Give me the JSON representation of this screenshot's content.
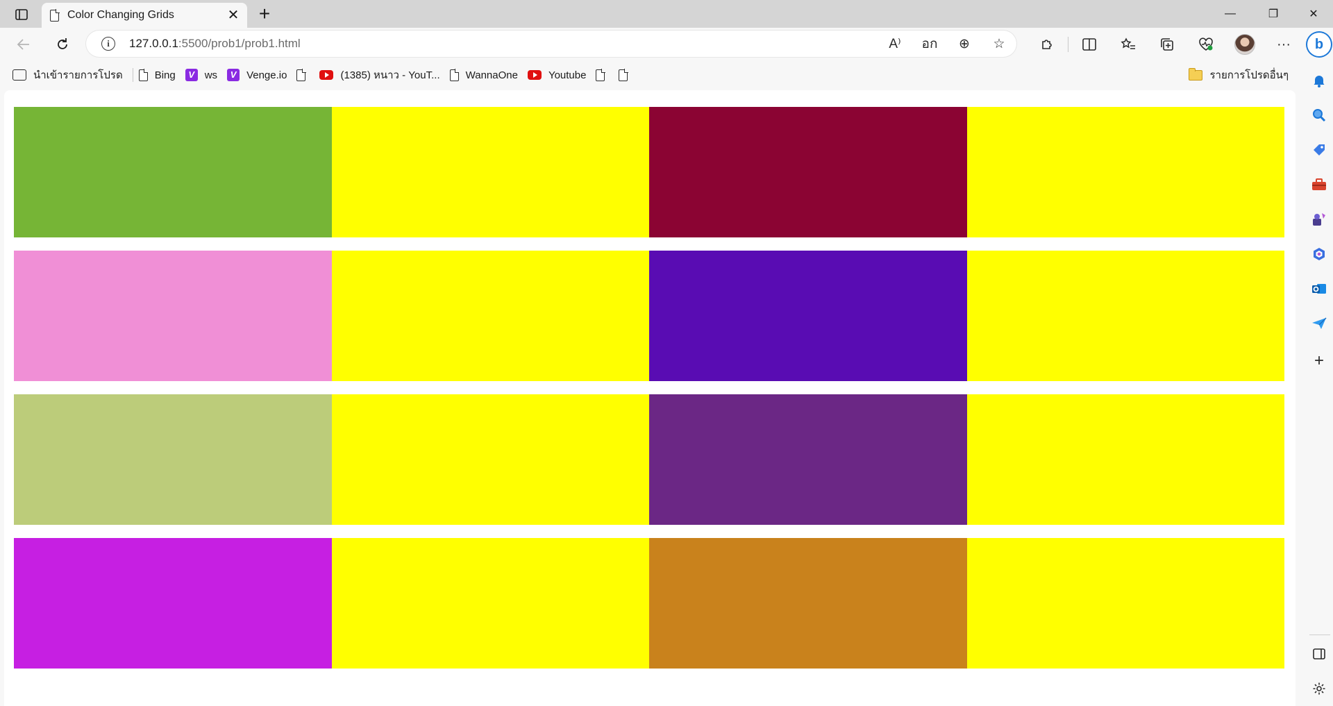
{
  "browser": {
    "tab": {
      "title": "Color Changing Grids",
      "close_glyph": "✕"
    },
    "new_tab_glyph": "+",
    "window_controls": {
      "minimize": "—",
      "restore": "❐",
      "close": "✕"
    },
    "address": {
      "host": "127.0.0.1",
      "path": ":5500/prob1/prob1.html"
    },
    "omnibox_icons": {
      "read_aloud": "A⁾",
      "translate": "อก",
      "zoom": "⊕",
      "favorite": "☆"
    },
    "toolbar": {
      "extensions": "⧉",
      "split": "◫",
      "favorites": "☆",
      "collections": "⧉",
      "performance": "♡",
      "menu": "···"
    }
  },
  "bookmarks": [
    {
      "label": "นำเข้ารายการโปรด",
      "icon": "import-icon"
    },
    {
      "label": "Bing",
      "icon": "doc-icon"
    },
    {
      "label": "ws",
      "icon": "v-icon"
    },
    {
      "label": "Venge.io",
      "icon": "v-icon"
    },
    {
      "label": "",
      "icon": "doc-icon"
    },
    {
      "label": "(1385) หนาว - YouT...",
      "icon": "youtube-icon"
    },
    {
      "label": "WannaOne",
      "icon": "doc-icon"
    },
    {
      "label": "Youtube",
      "icon": "youtube-icon"
    },
    {
      "label": "",
      "icon": "doc-icon"
    },
    {
      "label": "",
      "icon": "doc-icon"
    }
  ],
  "other_favorites": {
    "label": "รายการโปรดอื่นๆ",
    "icon": "folder-icon"
  },
  "grid": {
    "rows": 4,
    "cols": 4,
    "colors": [
      [
        "#76b536",
        "#ffff00",
        "#8b0433",
        "#ffff00"
      ],
      [
        "#f08fd6",
        "#ffff00",
        "#590cb3",
        "#ffff00"
      ],
      [
        "#bccc7a",
        "#ffff00",
        "#6b2785",
        "#ffff00"
      ],
      [
        "#c61fe2",
        "#ffff00",
        "#c9821c",
        "#ffff00"
      ]
    ]
  },
  "sidebar": {
    "bing_label": "b",
    "items": [
      "bell-icon",
      "search-icon",
      "shopping-tag-icon",
      "toolbox-icon",
      "games-icon",
      "microsoft365-icon",
      "outlook-icon",
      "send-icon",
      "add-icon"
    ],
    "add_glyph": "+",
    "bottom": {
      "panel": "◫",
      "settings": "⚙"
    },
    "colors": {
      "accent": "#1c78d8"
    }
  }
}
